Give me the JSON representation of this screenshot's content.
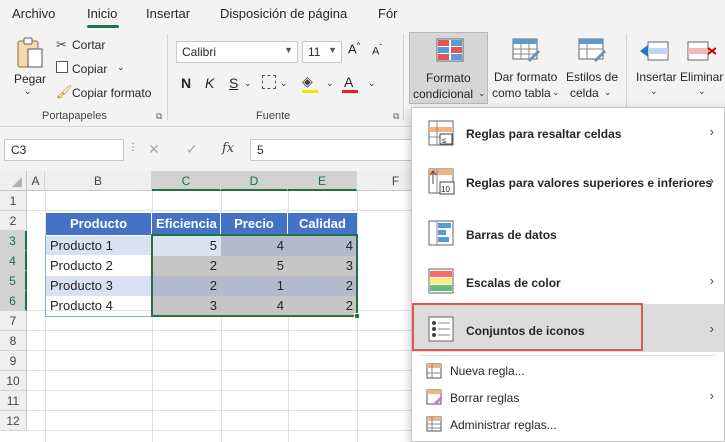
{
  "tabs": [
    "Archivo",
    "Inicio",
    "Insertar",
    "Disposición de página",
    "Fór"
  ],
  "ribbon": {
    "paste": "Pegar",
    "cut": "Cortar",
    "copy": "Copiar",
    "format_painter": "Copiar formato",
    "clipboard_group": "Portapapeles",
    "font_name": "Calibri",
    "font_size": "11",
    "bold": "N",
    "italic": "K",
    "underline": "S",
    "font_group": "Fuente",
    "conditional_format_1": "Formato",
    "conditional_format_2": "condicional",
    "table_format_1": "Dar formato",
    "table_format_2": "como tabla",
    "cell_styles_1": "Estilos de",
    "cell_styles_2": "celda",
    "insert": "Insertar",
    "delete": "Eliminar"
  },
  "formula_bar": {
    "name_box": "C3",
    "fx": "fx",
    "value": "5"
  },
  "columns": [
    "A",
    "B",
    "C",
    "D",
    "E",
    "F"
  ],
  "rows": [
    "1",
    "2",
    "3",
    "4",
    "5",
    "6",
    "7",
    "8",
    "9",
    "10",
    "11",
    "12"
  ],
  "table": {
    "headers": [
      "Producto",
      "Eficiencia",
      "Precio",
      "Calidad"
    ],
    "rows": [
      [
        "Producto 1",
        "5",
        "4",
        "4"
      ],
      [
        "Producto 2",
        "2",
        "5",
        "3"
      ],
      [
        "Producto 3",
        "2",
        "1",
        "2"
      ],
      [
        "Producto 4",
        "3",
        "4",
        "2"
      ]
    ]
  },
  "menu": {
    "items": [
      "Reglas para resaltar celdas",
      "Reglas para valores superiores e inferiores",
      "Barras de datos",
      "Escalas de color",
      "Conjuntos de iconos",
      "Nueva regla...",
      "Borrar reglas",
      "Administrar reglas..."
    ],
    "highlighted": "Conjuntos de iconos"
  },
  "colors": {
    "accent": "#217346",
    "table_header": "#4472c4",
    "table_band": "#d9e1f2",
    "highlight_box": "#e05555"
  }
}
